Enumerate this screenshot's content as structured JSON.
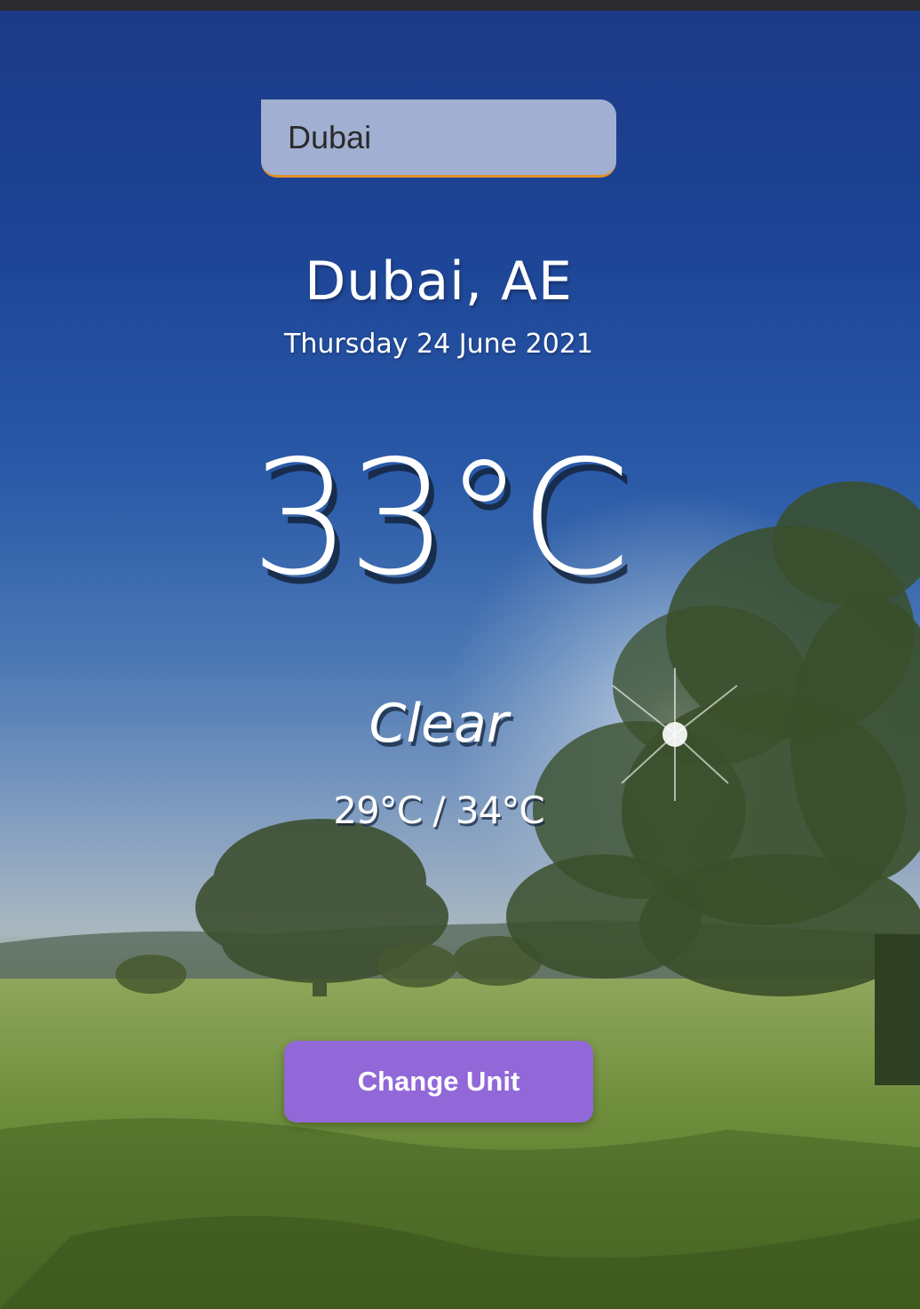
{
  "search": {
    "value": "Dubai"
  },
  "weather": {
    "location": "Dubai, AE",
    "date": "Thursday 24 June 2021",
    "temperature": "33°C",
    "condition": "Clear",
    "hi_low": "29°C / 34°C"
  },
  "controls": {
    "change_unit_label": "Change Unit"
  },
  "colors": {
    "button": "#9268d8",
    "search_accent": "#e0902a",
    "sky": "#1b3a86",
    "grass": "#5e7f31"
  }
}
